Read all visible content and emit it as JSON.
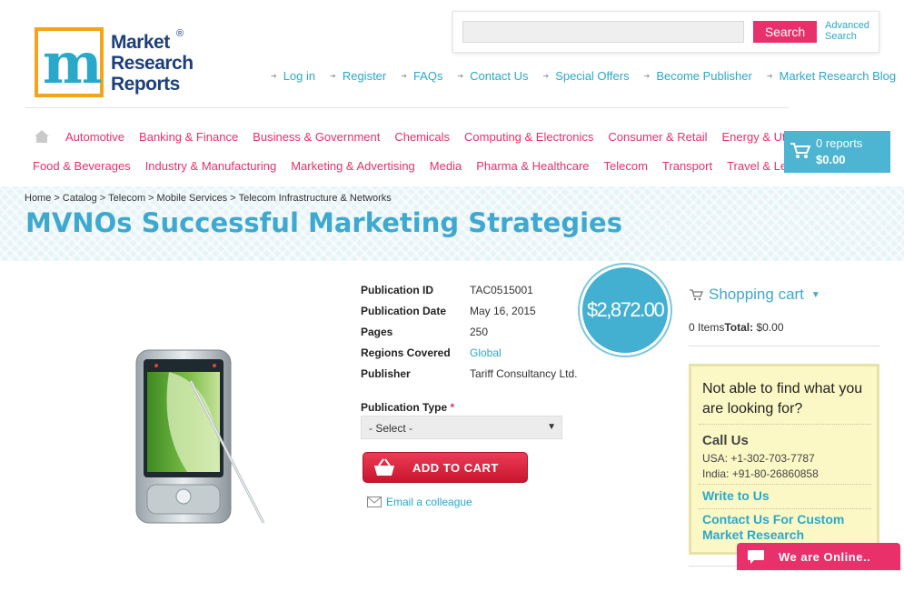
{
  "logo": {
    "letter": "m",
    "line1": "Market",
    "line2": "Research",
    "line3": "Reports",
    "reg": "®"
  },
  "search": {
    "placeholder": "",
    "button": "Search",
    "advanced_line1": "Advanced",
    "advanced_line2": "Search"
  },
  "toplinks": [
    "Log in",
    "Register",
    "FAQs",
    "Contact Us",
    "Special Offers",
    "Become Publisher",
    "Market Research Blog"
  ],
  "categories_row1": [
    "Automotive",
    "Banking & Finance",
    "Business & Government",
    "Chemicals",
    "Computing & Electronics",
    "Consumer & Retail",
    "Energy & Utilities"
  ],
  "categories_row2": [
    "Food & Beverages",
    "Industry & Manufacturing",
    "Marketing & Advertising",
    "Media",
    "Pharma & Healthcare",
    "Telecom",
    "Transport",
    "Travel & Leisure"
  ],
  "cart_badge": {
    "reports": "0 reports",
    "amount": "$0.00"
  },
  "breadcrumb": [
    "Home",
    "Catalog",
    "Telecom",
    "Mobile Services",
    "Telecom Infrastructure & Networks"
  ],
  "title": "MVNOs Successful Marketing Strategies",
  "details": {
    "pub_id_label": "Publication ID",
    "pub_id": "TAC0515001",
    "pub_date_label": "Publication Date",
    "pub_date": "May 16, 2015",
    "pages_label": "Pages",
    "pages": "250",
    "regions_label": "Regions Covered",
    "regions": "Global",
    "publisher_label": "Publisher",
    "publisher": "Tariff Consultancy Ltd."
  },
  "price": "$2,872.00",
  "pubtype": {
    "label": "Publication Type",
    "required": "*",
    "selected": "- Select -"
  },
  "add_to_cart": "ADD TO CART",
  "email_colleague": "Email a colleague",
  "sidebar": {
    "cart_title": "Shopping cart",
    "items": "0 Items",
    "total_label": "Total:",
    "total": "$0.00",
    "help_question": "Not able to find what you are looking for?",
    "call_us": "Call Us",
    "usa": "USA: +1-302-703-7787",
    "india": "India: +91-80-26860858",
    "write_to_us": "Write to Us",
    "contact_custom": "Contact Us For Custom Market Research"
  },
  "chat": "We are Online..",
  "colors": {
    "accent_blue": "#3fa8cf",
    "accent_pink": "#e8306a",
    "logo_orange": "#f7a21b"
  }
}
